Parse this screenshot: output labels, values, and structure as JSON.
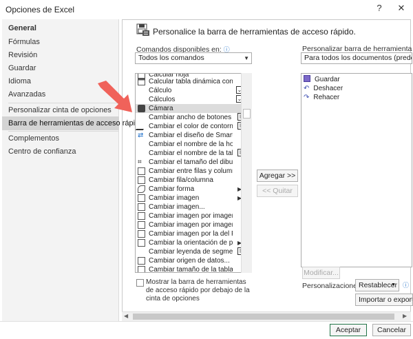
{
  "window": {
    "title": "Opciones de Excel",
    "help": "?",
    "close": "✕"
  },
  "sidebar": {
    "items": [
      {
        "label": "General"
      },
      {
        "label": "Fórmulas"
      },
      {
        "label": "Revisión"
      },
      {
        "label": "Guardar"
      },
      {
        "label": "Idioma"
      },
      {
        "label": "Avanzadas"
      },
      {
        "label": "Personalizar cinta de opciones"
      },
      {
        "label": "Barra de herramientas de acceso rápido"
      },
      {
        "label": "Complementos"
      },
      {
        "label": "Centro de confianza"
      }
    ]
  },
  "main": {
    "heading": "Personalice la barra de herramientas de acceso rápido.",
    "commands_label": "Comandos disponibles en:",
    "commands_value": "Todos los comandos",
    "customize_label": "Personalizar barra de herramientas de acc",
    "customize_value": "Para todos los documentos (predeterm",
    "commands": [
      {
        "label": "Calcular hoja",
        "icon": "sheet-icon"
      },
      {
        "label": "Calcular tabla dinámica con ...",
        "icon": "pivot-icon"
      },
      {
        "label": "Cálculo",
        "icon": "none"
      },
      {
        "label": "Cálculos",
        "icon": "none"
      },
      {
        "label": "Cámara",
        "icon": "camera-icon"
      },
      {
        "label": "Cambiar ancho de botones de...",
        "icon": "width-icon"
      },
      {
        "label": "Cambiar el color de contorno",
        "icon": "pen-icon"
      },
      {
        "label": "Cambiar el diseño de SmartArt",
        "icon": "smartart-icon"
      },
      {
        "label": "Cambiar el nombre de la hoja",
        "icon": "none"
      },
      {
        "label": "Cambiar el nombre de la tabla",
        "icon": "none"
      },
      {
        "label": "Cambiar el tamaño del dibujo",
        "icon": "crop-icon"
      },
      {
        "label": "Cambiar entre filas y columnas",
        "icon": "switch-icon"
      },
      {
        "label": "Cambiar fila/columna",
        "icon": "switch-icon"
      },
      {
        "label": "Cambiar forma",
        "icon": "shape-icon"
      },
      {
        "label": "Cambiar imagen",
        "icon": "image-icon"
      },
      {
        "label": "Cambiar imagen...",
        "icon": "image-icon"
      },
      {
        "label": "Cambiar imagen por imagen ...",
        "icon": "image-icon"
      },
      {
        "label": "Cambiar imagen por imagen ...",
        "icon": "image-icon"
      },
      {
        "label": "Cambiar imagen por la del P...",
        "icon": "image-icon"
      },
      {
        "label": "Cambiar la orientación de pá...",
        "icon": "orientation-icon"
      },
      {
        "label": "Cambiar leyenda de segment...",
        "icon": "none"
      },
      {
        "label": "Cambiar origen de datos...",
        "icon": "datasource-icon"
      },
      {
        "label": "Cambiar tamaño de la tabla",
        "icon": "table-icon"
      }
    ],
    "qat": [
      {
        "label": "Guardar",
        "icon": "save-icon"
      },
      {
        "label": "Deshacer",
        "icon": "undo-icon"
      },
      {
        "label": "Rehacer",
        "icon": "redo-icon"
      }
    ],
    "add_button": "Agregar >>",
    "remove_button": "<< Quitar",
    "modify_button": "Modificar...",
    "personalizations_label": "Personalizaciones:",
    "reset_button": "Restablecer",
    "import_button": "Importar o exportar",
    "show_below_label": "Mostrar la barra de herramientas de acceso rápido por debajo de la cinta de opciones"
  },
  "footer": {
    "accept": "Aceptar",
    "cancel": "Cancelar"
  },
  "colors": {
    "selection": "#d4d4d4",
    "accent": "#217346",
    "arrow": "#f0625a"
  }
}
